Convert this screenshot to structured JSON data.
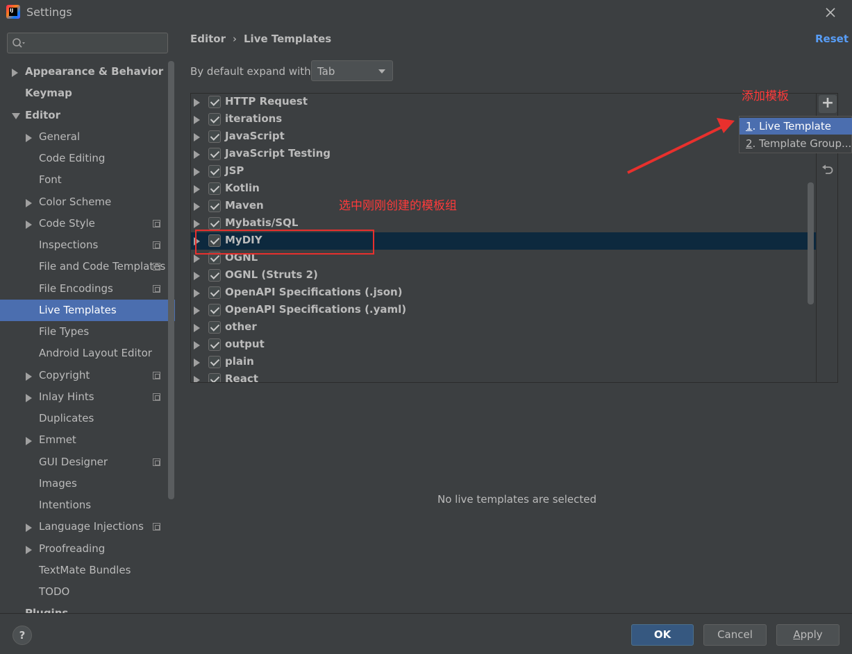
{
  "window": {
    "title": "Settings"
  },
  "sidebar": {
    "search_placeholder": "",
    "items": [
      {
        "label": "Appearance & Behavior",
        "level": 0,
        "arrow": "right",
        "bold": true,
        "copy": false
      },
      {
        "label": "Keymap",
        "level": 0,
        "arrow": "none",
        "bold": true,
        "copy": false
      },
      {
        "label": "Editor",
        "level": 0,
        "arrow": "down",
        "bold": true,
        "copy": false
      },
      {
        "label": "General",
        "level": 1,
        "arrow": "right",
        "bold": false,
        "copy": false
      },
      {
        "label": "Code Editing",
        "level": 1,
        "arrow": "none",
        "bold": false,
        "copy": false
      },
      {
        "label": "Font",
        "level": 1,
        "arrow": "none",
        "bold": false,
        "copy": false
      },
      {
        "label": "Color Scheme",
        "level": 1,
        "arrow": "right",
        "bold": false,
        "copy": false
      },
      {
        "label": "Code Style",
        "level": 1,
        "arrow": "right",
        "bold": false,
        "copy": true
      },
      {
        "label": "Inspections",
        "level": 1,
        "arrow": "none",
        "bold": false,
        "copy": true
      },
      {
        "label": "File and Code Templates",
        "level": 1,
        "arrow": "none",
        "bold": false,
        "copy": true
      },
      {
        "label": "File Encodings",
        "level": 1,
        "arrow": "none",
        "bold": false,
        "copy": true
      },
      {
        "label": "Live Templates",
        "level": 1,
        "arrow": "none",
        "bold": false,
        "copy": false,
        "selected": true
      },
      {
        "label": "File Types",
        "level": 1,
        "arrow": "none",
        "bold": false,
        "copy": false
      },
      {
        "label": "Android Layout Editor",
        "level": 1,
        "arrow": "none",
        "bold": false,
        "copy": false
      },
      {
        "label": "Copyright",
        "level": 1,
        "arrow": "right",
        "bold": false,
        "copy": true
      },
      {
        "label": "Inlay Hints",
        "level": 1,
        "arrow": "right",
        "bold": false,
        "copy": true
      },
      {
        "label": "Duplicates",
        "level": 1,
        "arrow": "none",
        "bold": false,
        "copy": false
      },
      {
        "label": "Emmet",
        "level": 1,
        "arrow": "right",
        "bold": false,
        "copy": false
      },
      {
        "label": "GUI Designer",
        "level": 1,
        "arrow": "none",
        "bold": false,
        "copy": true
      },
      {
        "label": "Images",
        "level": 1,
        "arrow": "none",
        "bold": false,
        "copy": false
      },
      {
        "label": "Intentions",
        "level": 1,
        "arrow": "none",
        "bold": false,
        "copy": false
      },
      {
        "label": "Language Injections",
        "level": 1,
        "arrow": "right",
        "bold": false,
        "copy": true
      },
      {
        "label": "Proofreading",
        "level": 1,
        "arrow": "right",
        "bold": false,
        "copy": false
      },
      {
        "label": "TextMate Bundles",
        "level": 1,
        "arrow": "none",
        "bold": false,
        "copy": false
      },
      {
        "label": "TODO",
        "level": 1,
        "arrow": "none",
        "bold": false,
        "copy": false
      },
      {
        "label": "Plugins",
        "level": 0,
        "arrow": "none",
        "bold": true,
        "copy": false
      }
    ]
  },
  "main": {
    "breadcrumb": {
      "parent": "Editor",
      "separator": "›",
      "current": "Live Templates"
    },
    "reset_label": "Reset",
    "expand_label": "By default expand with",
    "expand_value": "Tab",
    "templates": [
      {
        "name": "HTTP Request",
        "checked": true
      },
      {
        "name": "iterations",
        "checked": true
      },
      {
        "name": "JavaScript",
        "checked": true
      },
      {
        "name": "JavaScript Testing",
        "checked": true
      },
      {
        "name": "JSP",
        "checked": true
      },
      {
        "name": "Kotlin",
        "checked": true
      },
      {
        "name": "Maven",
        "checked": true
      },
      {
        "name": "Mybatis/SQL",
        "checked": true
      },
      {
        "name": "MyDIY",
        "checked": true,
        "selected": true
      },
      {
        "name": "OGNL",
        "checked": true
      },
      {
        "name": "OGNL (Struts 2)",
        "checked": true
      },
      {
        "name": "OpenAPI Specifications (.json)",
        "checked": true
      },
      {
        "name": "OpenAPI Specifications (.yaml)",
        "checked": true
      },
      {
        "name": "other",
        "checked": true
      },
      {
        "name": "output",
        "checked": true
      },
      {
        "name": "plain",
        "checked": true
      },
      {
        "name": "React",
        "checked": true
      }
    ],
    "add_label": "+",
    "popup": [
      {
        "num": "1",
        "text": ". Live Template"
      },
      {
        "num": "2",
        "text": ". Template Group..."
      }
    ],
    "empty_message": "No live templates are selected"
  },
  "annotations": {
    "add_template": "添加模板",
    "select_group": "选中刚刚创建的模板组",
    "color": "#ff3a3a"
  },
  "footer": {
    "help_label": "?",
    "ok_label": "OK",
    "cancel_label": "Cancel",
    "apply_label": "Apply"
  },
  "colors": {
    "background": "#3c3f41",
    "selection": "#4b6eaf",
    "row_selection": "#0d293e",
    "link": "#589df6",
    "primary_button": "#365880"
  }
}
